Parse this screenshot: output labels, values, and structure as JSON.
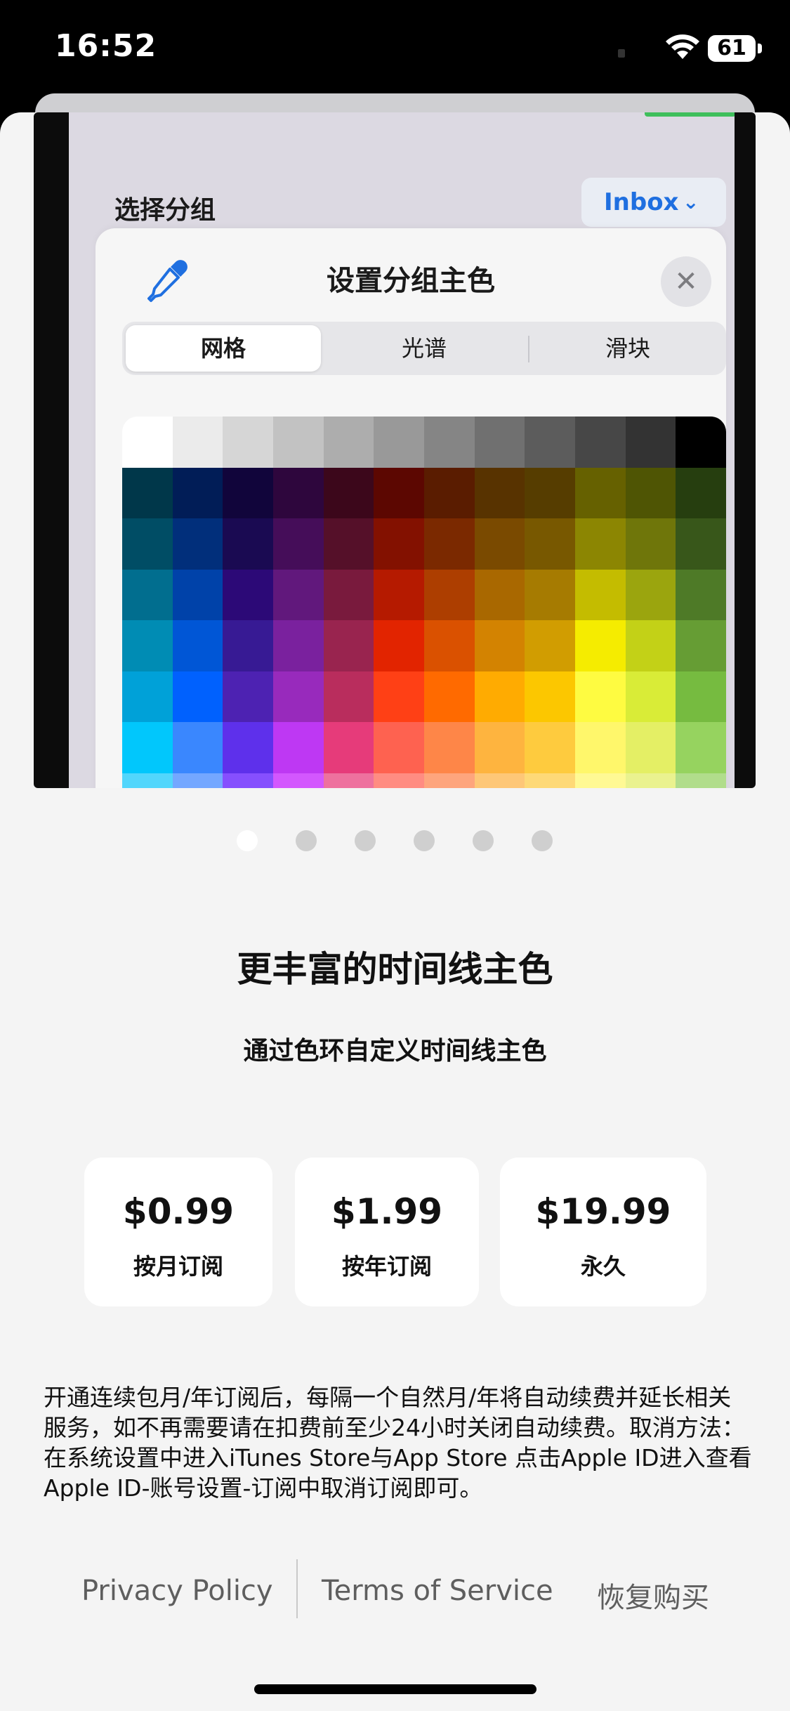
{
  "status_bar": {
    "time": "16:52",
    "battery": "61",
    "icons": [
      "cellular-icon",
      "wifi-icon",
      "battery-icon"
    ]
  },
  "preview": {
    "group_title": "选择分组",
    "inbox_label": "Inbox",
    "picker": {
      "title": "设置分组主色",
      "tabs": [
        "网格",
        "光谱",
        "滑块"
      ],
      "active_tab": 0,
      "grid_colors": [
        [
          "#ffffff",
          "#ebebeb",
          "#d6d6d6",
          "#c2c2c2",
          "#adadad",
          "#999999",
          "#858585",
          "#707070",
          "#5c5c5c",
          "#474747",
          "#333333",
          "#000000"
        ],
        [
          "#00374a",
          "#011d57",
          "#11053b",
          "#2e063d",
          "#3c071b",
          "#5c0701",
          "#5a1c00",
          "#583300",
          "#563d00",
          "#666100",
          "#4f5504",
          "#263e0f"
        ],
        [
          "#004d65",
          "#012f7b",
          "#1a0a52",
          "#450d59",
          "#551029",
          "#831100",
          "#7b2900",
          "#7a4a00",
          "#785800",
          "#8c8602",
          "#6f760a",
          "#38571a"
        ],
        [
          "#016e8f",
          "#0042a9",
          "#2c0977",
          "#61187c",
          "#791a3d",
          "#b51a00",
          "#ad3e00",
          "#a96800",
          "#a67b01",
          "#c4bc00",
          "#9ba50e",
          "#4e7a27"
        ],
        [
          "#008cb4",
          "#0056d6",
          "#371a94",
          "#7a219e",
          "#99244f",
          "#e22400",
          "#da5100",
          "#d38301",
          "#d19d01",
          "#f5ec00",
          "#c3d117",
          "#669d34"
        ],
        [
          "#00a1d8",
          "#0061fe",
          "#4d22b2",
          "#982abc",
          "#b92d5d",
          "#ff4015",
          "#ff6a00",
          "#ffab01",
          "#fcc700",
          "#fefb41",
          "#d9ec37",
          "#76bb40"
        ],
        [
          "#01c7fc",
          "#3a87fe",
          "#5e30eb",
          "#be38f3",
          "#e63b7a",
          "#fe6250",
          "#fe8648",
          "#feb43f",
          "#fecb3e",
          "#fff76b",
          "#e4ef65",
          "#96d35f"
        ],
        [
          "#52d6fc",
          "#74a7ff",
          "#864ffe",
          "#d357fe",
          "#ee719e",
          "#ff8c82",
          "#fea57d",
          "#fec777",
          "#fed977",
          "#fff994",
          "#eaf28f",
          "#b1dd8b"
        ]
      ]
    }
  },
  "pager": {
    "count": 6,
    "active": 0
  },
  "headline": "更丰富的时间线主色",
  "subline": "通过色环自定义时间线主色",
  "plans": [
    {
      "price": "$0.99",
      "label": "按月订阅"
    },
    {
      "price": "$1.99",
      "label": "按年订阅"
    },
    {
      "price": "$19.99",
      "label": "永久"
    }
  ],
  "terms_text": "开通连续包月/年订阅后，每隔一个自然月/年将自动续费并延长相关服务，如不再需要请在扣费前至少24小时关闭自动续费。取消方法：在系统设置中进入iTunes Store与App Store 点击Apple ID进入查看Apple ID-账号设置-订阅中取消订阅即可。",
  "footer": {
    "privacy": "Privacy Policy",
    "terms": "Terms of Service",
    "restore": "恢复购买"
  }
}
